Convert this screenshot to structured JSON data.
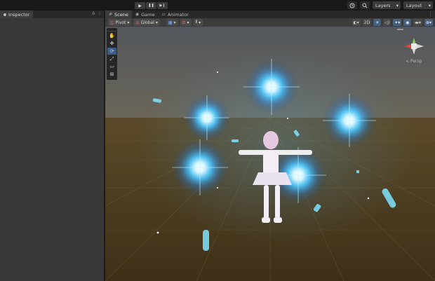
{
  "toolbar": {
    "play_icon": "play-icon",
    "pause_icon": "pause-icon",
    "step_icon": "step-icon",
    "play": "▶",
    "pause": "❚❚",
    "step": "▶❙",
    "history_icon": "history-icon",
    "search_icon": "search-icon",
    "layers_label": "Layers",
    "layout_label": "Layout"
  },
  "inspector": {
    "tab_label": "Inspector",
    "lock_glyph": "ô",
    "menu_glyph": "⋮"
  },
  "scene": {
    "tabs": [
      {
        "label": "Scene",
        "glyph": "#",
        "active": true
      },
      {
        "label": "Game",
        "glyph": "◉",
        "active": false
      },
      {
        "label": "Animator",
        "glyph": "⚏",
        "active": false
      }
    ],
    "menu_glyph": "⋮",
    "pivot_label": "Pivot",
    "global_label": "Global",
    "mode_2d": "2D",
    "persp_label": "< Persp"
  },
  "tools": [
    "✋",
    "✥",
    "⟳",
    "⤢",
    "▭",
    "⊞"
  ],
  "colors": {
    "ground": "#4a3a1e",
    "sky": "#4b4f55",
    "glow": "#5fd4ff",
    "accent": "#46607c"
  }
}
